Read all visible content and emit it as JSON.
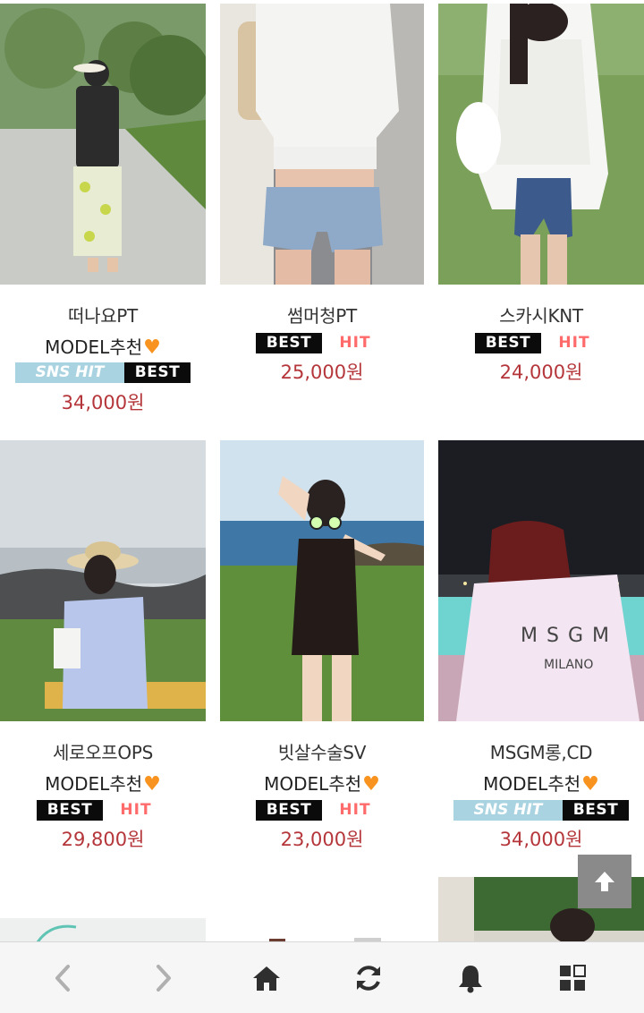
{
  "products": [
    {
      "name": "떠나요PT",
      "model": "MODEL추천",
      "badges": [
        "SNS HIT",
        "BEST"
      ],
      "price": "34,000원"
    },
    {
      "name": "썸머청PT",
      "model": "",
      "badges": [
        "BEST",
        "HIT"
      ],
      "price": "25,000원"
    },
    {
      "name": "스카시KNT",
      "model": "",
      "badges": [
        "BEST",
        "HIT"
      ],
      "price": "24,000원"
    },
    {
      "name": "세로오프OPS",
      "model": "MODEL추천",
      "badges": [
        "BEST",
        "HIT"
      ],
      "price": "29,800원"
    },
    {
      "name": "빗살수술SV",
      "model": "MODEL추천",
      "badges": [
        "BEST",
        "HIT"
      ],
      "price": "23,000원"
    },
    {
      "name": "MSGM롱,CD",
      "model": "MODEL추천",
      "badges": [
        "SNS HIT",
        "BEST"
      ],
      "price": "34,000원"
    }
  ],
  "photo_text": {
    "msgm_brand": "MSGM",
    "msgm_city": "MILANO"
  },
  "colors": {
    "price": "#b5363a",
    "heart": "#f7931e",
    "best_bg": "#0b0b0b",
    "hit_text": "#ff6b6b",
    "sns_bg": "#a9d3e0"
  },
  "icons": {
    "heart": "heart-icon",
    "scroll_top": "arrow-up-icon",
    "nav": [
      "chevron-left-icon",
      "chevron-right-icon",
      "home-icon",
      "refresh-icon",
      "bell-icon",
      "grid-icon"
    ]
  }
}
